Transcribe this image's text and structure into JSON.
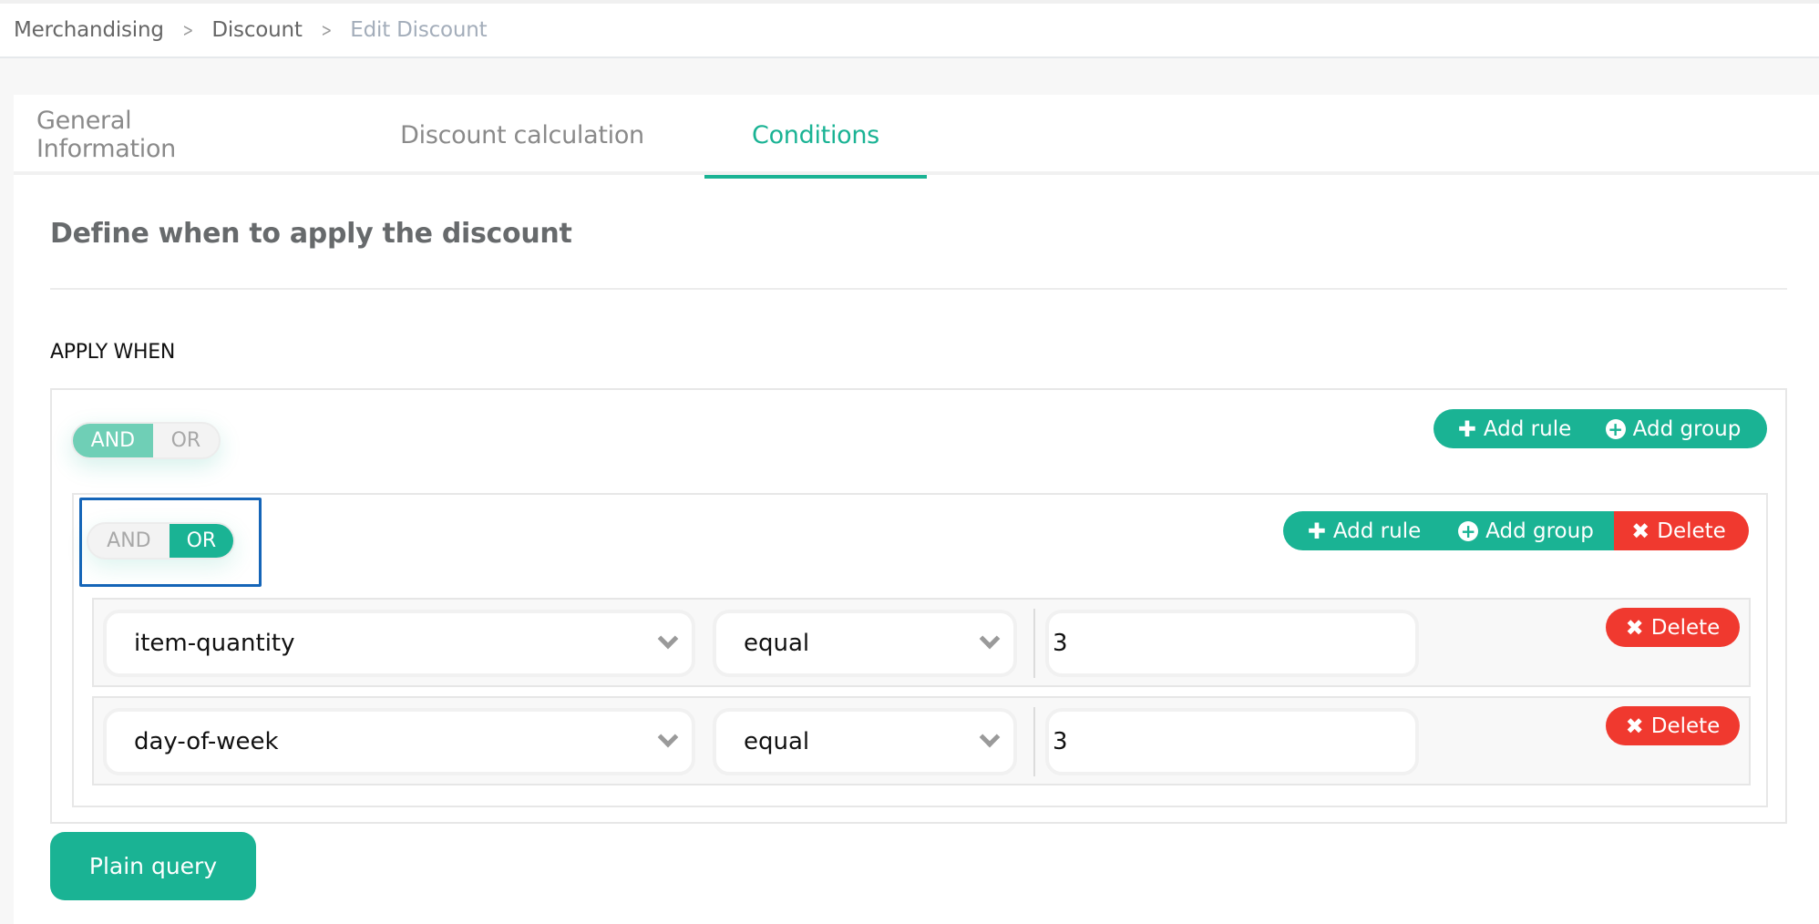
{
  "breadcrumb": {
    "items": [
      "Merchandising",
      "Discount"
    ],
    "current": "Edit Discount",
    "separator_icon": "chevron-right-icon"
  },
  "tabs": [
    {
      "label": "General Information",
      "active": false
    },
    {
      "label": "Discount calculation",
      "active": false
    },
    {
      "label": "Conditions",
      "active": true
    }
  ],
  "section": {
    "title": "Define when to apply the discount",
    "apply_label": "APPLY WHEN"
  },
  "colors": {
    "accent": "#1ab394",
    "danger": "#f0392f",
    "focus": "#1565b8"
  },
  "outer_group": {
    "combinator": {
      "and_label": "AND",
      "or_label": "OR",
      "selected": "AND"
    },
    "actions": {
      "add_rule": "Add rule",
      "add_group": "Add group"
    }
  },
  "inner_group": {
    "combinator": {
      "and_label": "AND",
      "or_label": "OR",
      "selected": "OR"
    },
    "actions": {
      "add_rule": "Add rule",
      "add_group": "Add group",
      "delete": "Delete"
    },
    "rules": [
      {
        "field": "item-quantity",
        "operator": "equal",
        "value": "3",
        "delete_label": "Delete"
      },
      {
        "field": "day-of-week",
        "operator": "equal",
        "value": "3",
        "delete_label": "Delete"
      }
    ]
  },
  "footer": {
    "plain_query_label": "Plain query"
  }
}
